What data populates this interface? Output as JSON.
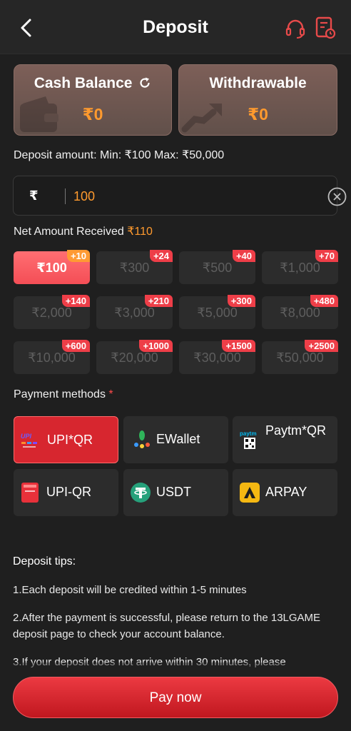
{
  "header": {
    "title": "Deposit",
    "back_icon": "back-arrow-icon",
    "support_icon": "headset-icon",
    "record_icon": "deposit-record-icon"
  },
  "balances": [
    {
      "label": "Cash Balance",
      "value": "₹0",
      "icon": "refresh-icon"
    },
    {
      "label": "Withdrawable",
      "value": "₹0"
    }
  ],
  "deposit_limits": "Deposit amount: Min: ₹100 Max: ₹50,000",
  "amount_input": {
    "currency": "₹",
    "value": "100"
  },
  "net_amount": {
    "label": "Net Amount Received",
    "value": "₹110"
  },
  "amount_options": [
    {
      "amount": "₹100",
      "bonus": "+10",
      "selected": true
    },
    {
      "amount": "₹300",
      "bonus": "+24"
    },
    {
      "amount": "₹500",
      "bonus": "+40"
    },
    {
      "amount": "₹1,000",
      "bonus": "+70"
    },
    {
      "amount": "₹2,000",
      "bonus": "+140"
    },
    {
      "amount": "₹3,000",
      "bonus": "+210"
    },
    {
      "amount": "₹5,000",
      "bonus": "+300"
    },
    {
      "amount": "₹8,000",
      "bonus": "+480"
    },
    {
      "amount": "₹10,000",
      "bonus": "+600"
    },
    {
      "amount": "₹20,000",
      "bonus": "+1000"
    },
    {
      "amount": "₹30,000",
      "bonus": "+1500"
    },
    {
      "amount": "₹50,000",
      "bonus": "+2500"
    }
  ],
  "payment_methods": {
    "title": "Payment methods",
    "required_mark": "*",
    "items": [
      {
        "label": "UPI*QR",
        "icon": "upi-logo-icon",
        "selected": true
      },
      {
        "label": "EWallet",
        "icon": "ewallet-icon"
      },
      {
        "label": "Paytm*QR",
        "icon": "paytm-qr-icon"
      },
      {
        "label": "UPI-QR",
        "icon": "upi-qr-icon"
      },
      {
        "label": "USDT",
        "icon": "tether-icon"
      },
      {
        "label": "ARPAY",
        "icon": "arpay-icon"
      }
    ]
  },
  "tips": {
    "title": "Deposit tips:",
    "items": [
      "1.Each deposit will be credited within 1-5 minutes",
      "2.After the payment is successful, please return to the 13LGAME deposit page to check your account balance.",
      "3.If your deposit does not arrive within 30 minutes, please"
    ]
  },
  "pay_button": "Pay now",
  "colors": {
    "accent": "#e8313a",
    "highlight": "#ff9a2e",
    "background": "#1f1f1f",
    "card": "#2c2c2c"
  }
}
